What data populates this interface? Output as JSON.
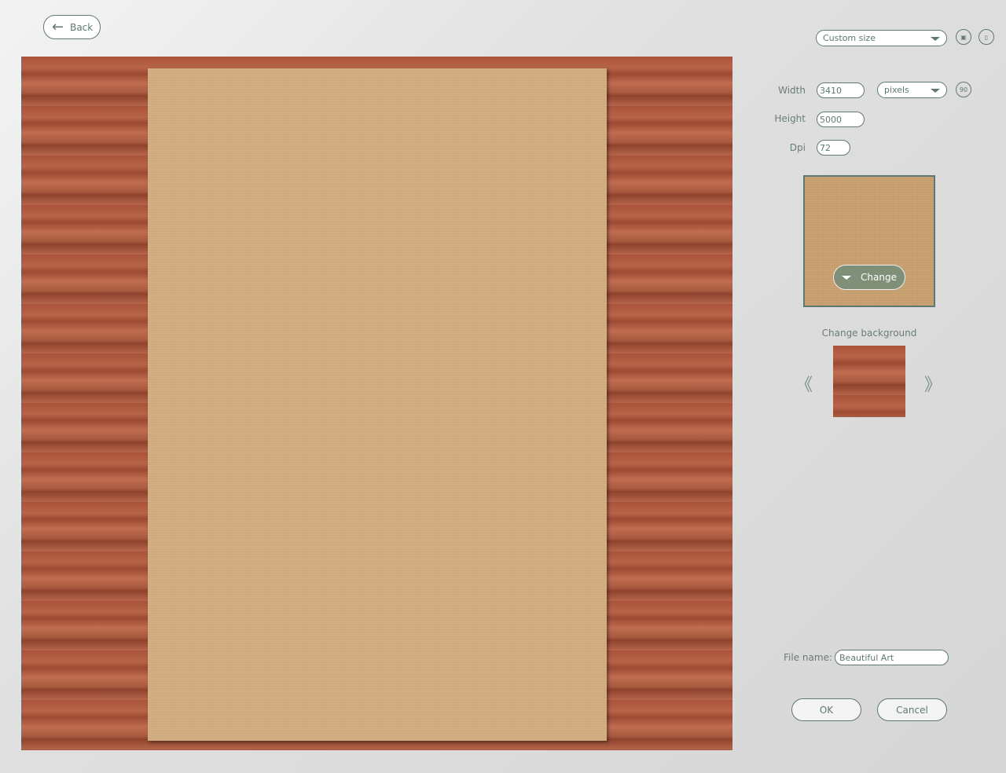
{
  "back": {
    "label": "Back",
    "icon": "arrow-left-icon"
  },
  "preset": {
    "value": "Custom size"
  },
  "icons": {
    "save": "save-icon",
    "delete": "trash-icon",
    "rotate": "rotate-90-icon",
    "rotate_text": "90"
  },
  "size": {
    "width_label": "Width",
    "width": "3410",
    "height_label": "Height",
    "height": "5000",
    "dpi_label": "Dpi",
    "dpi": "72",
    "unit": "pixels"
  },
  "texture": {
    "change_label": "Change"
  },
  "background": {
    "label": "Change background",
    "prev": "《",
    "next": "》"
  },
  "file": {
    "label": "File name:",
    "value": "Beautiful Art"
  },
  "actions": {
    "ok": "OK",
    "cancel": "Cancel"
  }
}
